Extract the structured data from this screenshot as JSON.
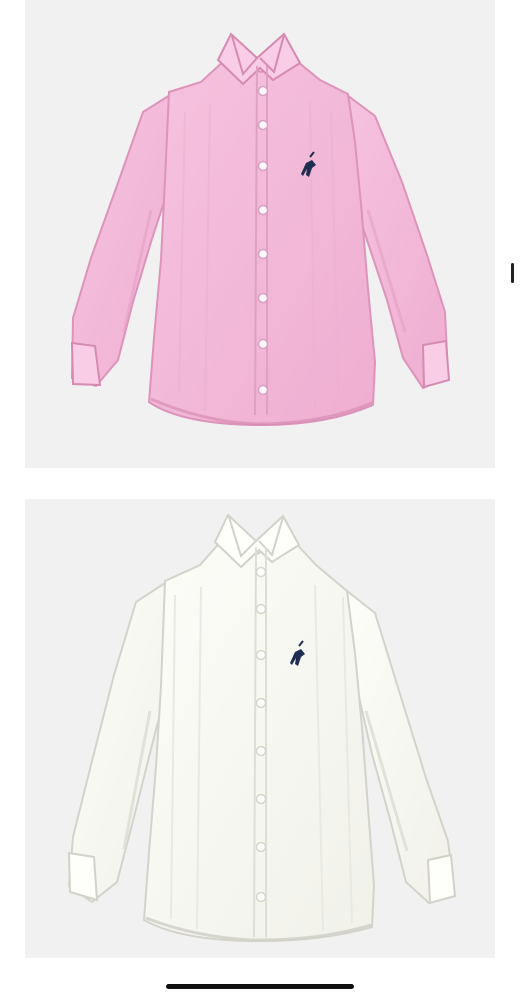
{
  "colors": {
    "page_background": "#ffffff",
    "photo_background": "#f1f1f1",
    "pink_shirt": "#f4b9d9",
    "pink_shirt_shadow": "#e7a2c6",
    "white_shirt": "#fbfbf6",
    "white_shirt_shadow": "#e2e2dc",
    "logo": "#1f2d52",
    "scroll_indicator": "#222222",
    "home_indicator": "#111111"
  },
  "gallery": {
    "items": [
      {
        "icon": "pink-oxford-shirt-icon"
      },
      {
        "icon": "white-oxford-shirt-icon"
      }
    ]
  },
  "controls": {
    "scroll_indicator": "vertical-scroll-indicator",
    "home_indicator": "home-indicator-bar"
  }
}
